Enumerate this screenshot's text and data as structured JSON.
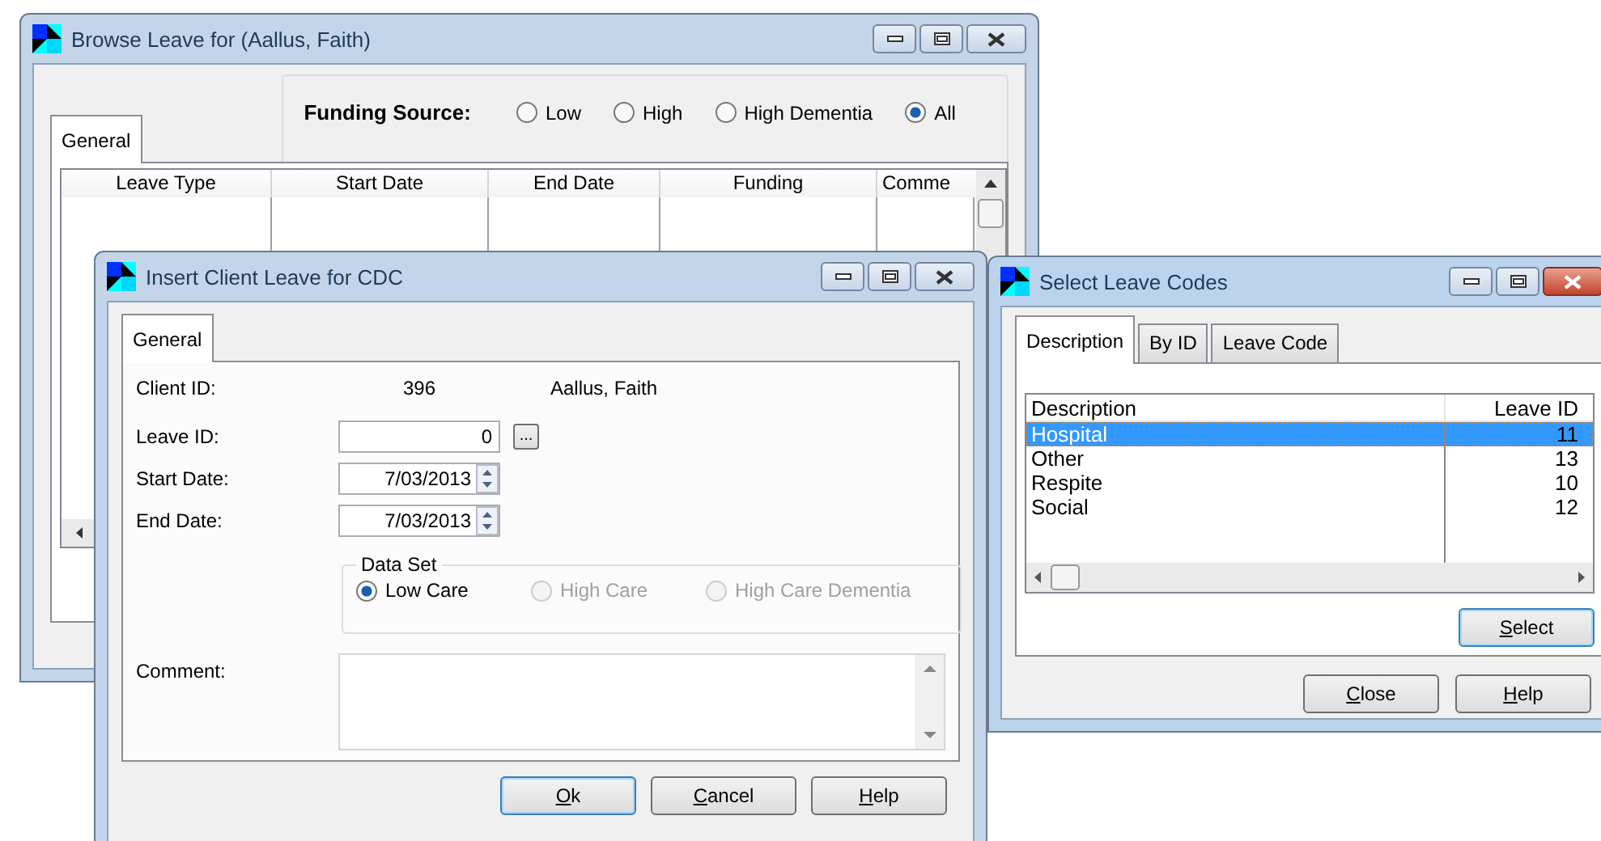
{
  "browse_window": {
    "title": "Browse Leave for (Aallus, Faith)",
    "active": false,
    "tabs": [
      {
        "label": "General",
        "selected": true
      }
    ],
    "funding_source": {
      "label": "Funding Source:",
      "options": [
        {
          "label": "Low",
          "selected": false
        },
        {
          "label": "High",
          "selected": false
        },
        {
          "label": "High Dementia",
          "selected": false
        },
        {
          "label": "All",
          "selected": true
        }
      ]
    },
    "table": {
      "columns": [
        "Leave Type",
        "Start Date",
        "End Date",
        "Funding",
        "Comme"
      ]
    }
  },
  "insert_window": {
    "title": "Insert Client Leave for CDC",
    "active": false,
    "tabs": [
      {
        "label": "General",
        "selected": true
      }
    ],
    "client_id": {
      "label": "Client ID:",
      "value": "396",
      "name": "Aallus, Faith"
    },
    "leave_id": {
      "label": "Leave ID:",
      "value": "0",
      "browse_button": "..."
    },
    "start_date": {
      "label": "Start Date:",
      "value": "7/03/2013"
    },
    "end_date": {
      "label": "End Date:",
      "value": "7/03/2013"
    },
    "data_set": {
      "label": "Data Set",
      "options": [
        {
          "label": "Low Care",
          "selected": true,
          "disabled": false
        },
        {
          "label": "High Care",
          "selected": false,
          "disabled": true
        },
        {
          "label": "High Care Dementia",
          "selected": false,
          "disabled": true
        }
      ]
    },
    "comment": {
      "label": "Comment:"
    },
    "buttons": [
      {
        "label": "Ok",
        "default": true
      },
      {
        "label": "Cancel",
        "default": false
      },
      {
        "label": "Help",
        "default": false
      }
    ]
  },
  "codes_window": {
    "title": "Select Leave Codes",
    "active": true,
    "tabs": [
      {
        "label": "Description",
        "selected": true
      },
      {
        "label": "By ID",
        "selected": false
      },
      {
        "label": "Leave Code",
        "selected": false
      }
    ],
    "table": {
      "columns": [
        "Description",
        "Leave ID"
      ],
      "rows": [
        {
          "description": "Hospital",
          "leave_id": "11",
          "selected": true
        },
        {
          "description": "Other",
          "leave_id": "13",
          "selected": false
        },
        {
          "description": "Respite",
          "leave_id": "10",
          "selected": false
        },
        {
          "description": "Social",
          "leave_id": "12",
          "selected": false
        }
      ]
    },
    "select_button": {
      "label": "Select",
      "default": true
    },
    "buttons": [
      {
        "label": "Close",
        "default": false
      },
      {
        "label": "Help",
        "default": false
      }
    ]
  }
}
